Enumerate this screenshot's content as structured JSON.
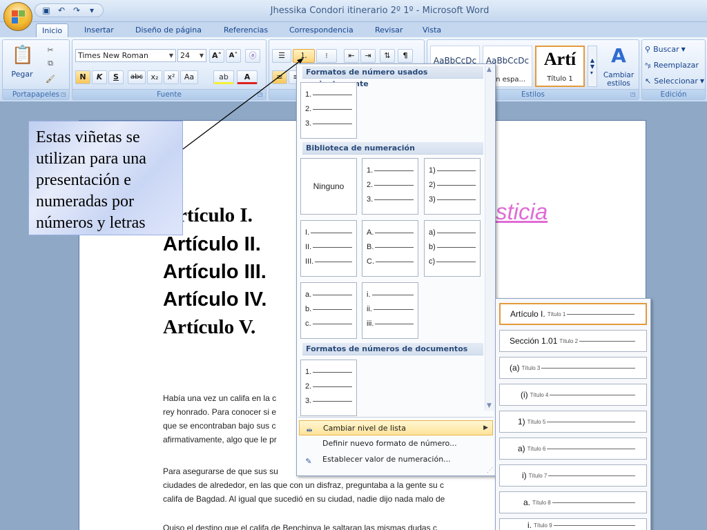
{
  "window": {
    "title": "Jhessika Condori itinerario 2º 1º - Microsoft Word"
  },
  "tabs": [
    "Inicio",
    "Insertar",
    "Diseño de página",
    "Referencias",
    "Correspondencia",
    "Revisar",
    "Vista"
  ],
  "ribbon": {
    "clipboard": {
      "label": "Portapapeles",
      "paste": "Pegar"
    },
    "font": {
      "label": "Fuente",
      "font_name": "Times New Roman",
      "font_size": "24",
      "bold": "N",
      "italic": "K",
      "underline": "S",
      "strike": "abc",
      "sub": "x₂",
      "sup": "x²",
      "case": "Aa"
    },
    "paragraph": {
      "pilcrow": "¶"
    },
    "styles": {
      "label": "Estilos",
      "card1_preview": "AaBbCcDc",
      "card1_name": "",
      "card2_preview": "AaBbCcDc",
      "card2_name": "Sin espa...",
      "card3_preview": "Artí",
      "card3_name": "Título 1",
      "change_styles": "Cambiar estilos"
    },
    "editing": {
      "label": "Edición",
      "find": "Buscar",
      "replace": "Reemplazar",
      "select": "Seleccionar"
    }
  },
  "document": {
    "articles": [
      "rtículo I.",
      "Artículo II.",
      "Artículo III.",
      "Artículo IV.",
      "Artículo V."
    ],
    "pink_text": "sticia",
    "para1": [
      "Había una vez un califa en la c",
      "rey honrado. Para conocer si e",
      "que se encontraban bajo sus c",
      "afirmativamente, algo que le pr"
    ],
    "para2": [
      "Para asegurarse de que sus su",
      "ciudades de alrededor, en las que con un disfraz, preguntaba a la gente su c",
      "califa de Bagdad. Al igual que sucedió en su ciudad, nadie dijo nada malo de"
    ],
    "para3": "Quiso el destino que el califa de Benchinya le saltaran las mismas dudas c"
  },
  "callout": {
    "lines": [
      "Estas viñetas se",
      "utilizan para una",
      "presentación e",
      "numeradas por",
      "números y letras"
    ]
  },
  "numbering_menu": {
    "recent_header": "Formatos de número usados recientemente",
    "library_header": "Biblioteca de numeración",
    "document_header": "Formatos de números de documentos",
    "none_label": "Ninguno",
    "recent_tile": [
      "1.",
      "2.",
      "3."
    ],
    "lib_tiles": [
      [
        "1.",
        "2.",
        "3."
      ],
      [
        "1)",
        "2)",
        "3)"
      ],
      [
        "I.",
        "II.",
        "III."
      ],
      [
        "A.",
        "B.",
        "C."
      ],
      [
        "a)",
        "b)",
        "c)"
      ],
      [
        "a.",
        "b.",
        "c."
      ],
      [
        "i.",
        "ii.",
        "iii."
      ]
    ],
    "doc_tile": [
      "1.",
      "2.",
      "3."
    ],
    "item_change_level": "Cambiar nivel de lista",
    "item_define": "Definir nuevo formato de número...",
    "item_set_value": "Establecer valor de numeración..."
  },
  "list_levels": [
    {
      "num": "Artículo I.",
      "label": "Título 1"
    },
    {
      "num": "Sección 1.01",
      "label": "Título 2"
    },
    {
      "num": "(a)",
      "label": "Título 3"
    },
    {
      "num": "(i)",
      "label": "Título 4"
    },
    {
      "num": "1)",
      "label": "Título 5"
    },
    {
      "num": "a)",
      "label": "Título 6"
    },
    {
      "num": "i)",
      "label": "Título 7"
    },
    {
      "num": "a.",
      "label": "Título 8"
    },
    {
      "num": "i.",
      "label": "Título 9"
    }
  ]
}
